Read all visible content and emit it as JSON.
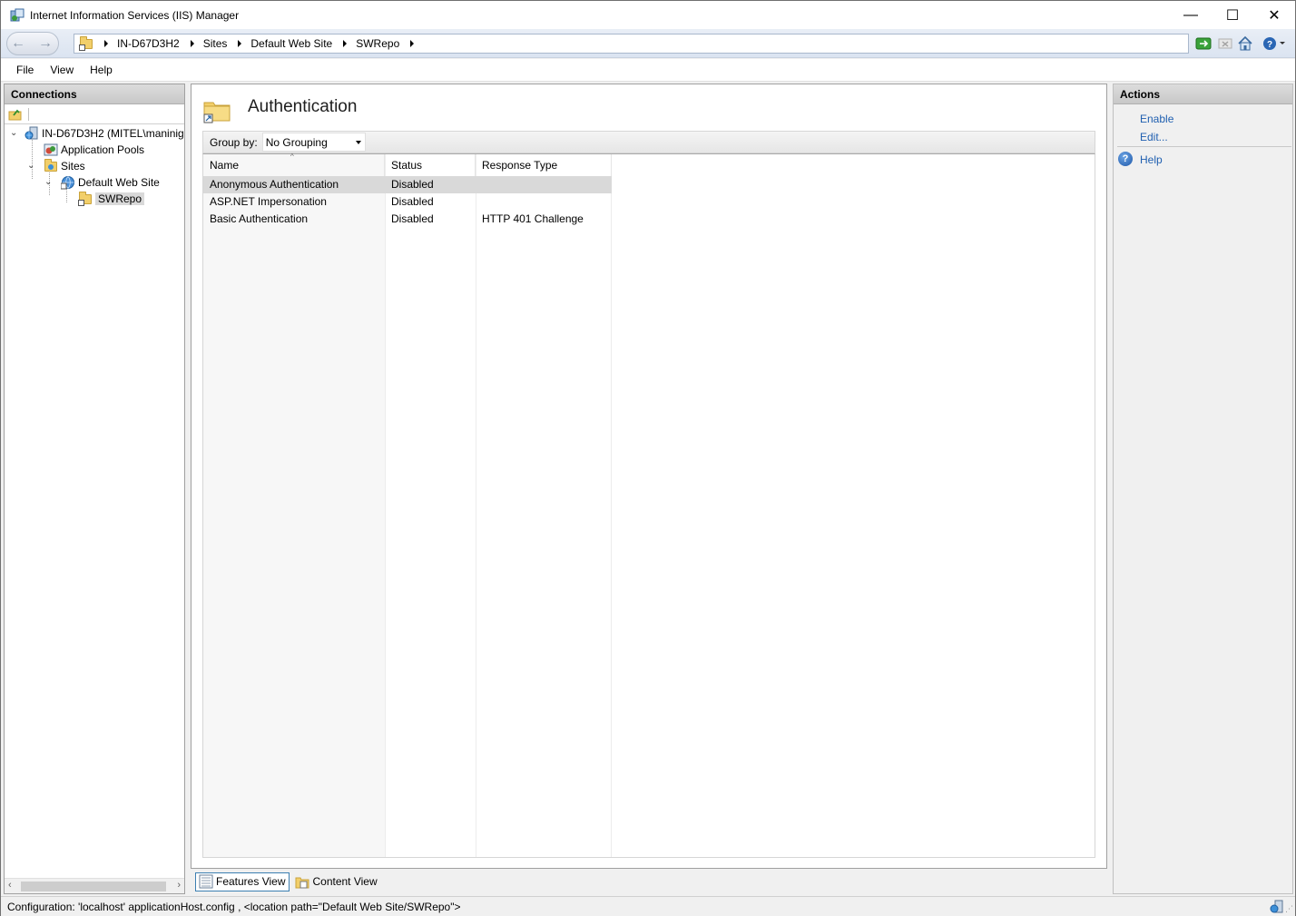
{
  "window": {
    "title": "Internet Information Services (IIS) Manager",
    "minimize": "—",
    "maximize": "☐",
    "close": "✕"
  },
  "address": {
    "crumbs": [
      "IN-D67D3H2",
      "Sites",
      "Default Web Site",
      "SWRepo"
    ]
  },
  "menu": {
    "file": "File",
    "view": "View",
    "help": "Help"
  },
  "connections": {
    "header": "Connections",
    "tree": {
      "server": "IN-D67D3H2 (MITEL\\maninig",
      "app_pools": "Application Pools",
      "sites": "Sites",
      "default_site": "Default Web Site",
      "swrepo": "SWRepo"
    }
  },
  "main": {
    "title": "Authentication",
    "group_by_label": "Group by:",
    "group_by_value": "No Grouping",
    "columns": [
      "Name",
      "Status",
      "Response Type"
    ],
    "rows": [
      {
        "name": "Anonymous Authentication",
        "status": "Disabled",
        "response": ""
      },
      {
        "name": "ASP.NET Impersonation",
        "status": "Disabled",
        "response": ""
      },
      {
        "name": "Basic Authentication",
        "status": "Disabled",
        "response": "HTTP 401 Challenge"
      }
    ],
    "selected_row": 0
  },
  "view_tabs": {
    "features": "Features View",
    "content": "Content View"
  },
  "actions": {
    "header": "Actions",
    "enable": "Enable",
    "edit": "Edit...",
    "help": "Help"
  },
  "status": {
    "text": "Configuration: 'localhost' applicationHost.config , <location path=\"Default Web Site/SWRepo\">"
  },
  "colors": {
    "link": "#1f5fb0",
    "selection": "#d9d9d9",
    "header_gray": "#c8c8c8"
  }
}
